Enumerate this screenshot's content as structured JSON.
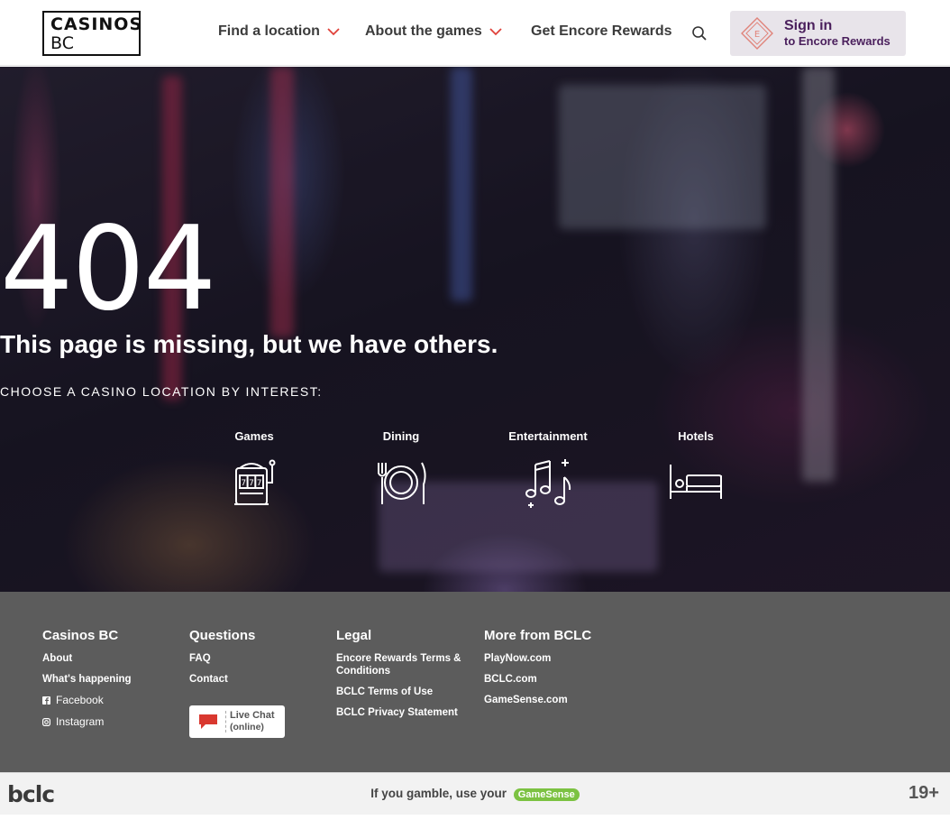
{
  "header": {
    "logo_line1": "CASINOS",
    "logo_line2": "BC",
    "nav": [
      {
        "label": "Find a location"
      },
      {
        "label": "About the games"
      },
      {
        "label": "Get Encore Rewards"
      }
    ],
    "signin_title": "Sign in",
    "signin_subtitle": "to Encore Rewards",
    "signin_badge_letter": "E"
  },
  "hero": {
    "code": "404",
    "message": "This page is missing, but we have others.",
    "choose": "CHOOSE A CASINO LOCATION BY INTEREST:",
    "interests": [
      {
        "label": "Games",
        "icon": "slot-machine-icon"
      },
      {
        "label": "Dining",
        "icon": "dining-plate-icon"
      },
      {
        "label": "Entertainment",
        "icon": "music-notes-icon"
      },
      {
        "label": "Hotels",
        "icon": "bed-icon"
      }
    ]
  },
  "footer": {
    "columns": [
      {
        "heading": "Casinos BC",
        "links": [
          "About",
          "What's happening"
        ],
        "social": [
          "Facebook",
          "Instagram"
        ]
      },
      {
        "heading": "Questions",
        "links": [
          "FAQ",
          "Contact"
        ]
      },
      {
        "heading": "Legal",
        "links": [
          "Encore Rewards Terms & Conditions",
          "BCLC Terms of Use",
          "BCLC Privacy Statement"
        ]
      },
      {
        "heading": "More from BCLC",
        "links": [
          "PlayNow.com",
          "BCLC.com",
          "GameSense.com"
        ]
      }
    ],
    "livechat_line1": "Live Chat",
    "livechat_line2": "(online)"
  },
  "bottombar": {
    "logo": "bclc",
    "gamble_text": "If you gamble, use your",
    "gamesense": "GameSense",
    "age": "19+"
  },
  "colors": {
    "accent_red": "#e0413a",
    "signin_bg": "#e8e4ea",
    "signin_text": "#4a1f5c",
    "footer_bg": "#5c5c5c",
    "gamesense_green": "#7cc242"
  }
}
